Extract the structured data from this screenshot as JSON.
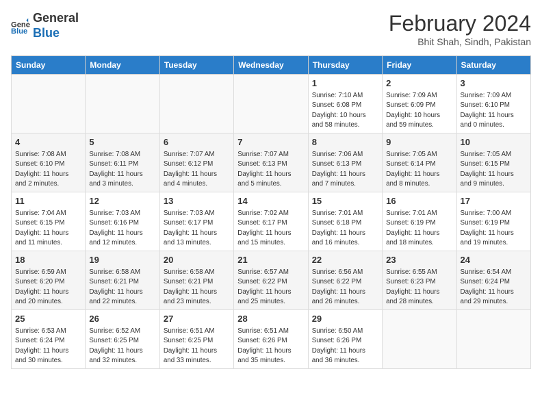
{
  "header": {
    "logo_general": "General",
    "logo_blue": "Blue",
    "month_title": "February 2024",
    "subtitle": "Bhit Shah, Sindh, Pakistan"
  },
  "days_of_week": [
    "Sunday",
    "Monday",
    "Tuesday",
    "Wednesday",
    "Thursday",
    "Friday",
    "Saturday"
  ],
  "weeks": [
    [
      {
        "day": "",
        "info": ""
      },
      {
        "day": "",
        "info": ""
      },
      {
        "day": "",
        "info": ""
      },
      {
        "day": "",
        "info": ""
      },
      {
        "day": "1",
        "info": "Sunrise: 7:10 AM\nSunset: 6:08 PM\nDaylight: 10 hours\nand 58 minutes."
      },
      {
        "day": "2",
        "info": "Sunrise: 7:09 AM\nSunset: 6:09 PM\nDaylight: 10 hours\nand 59 minutes."
      },
      {
        "day": "3",
        "info": "Sunrise: 7:09 AM\nSunset: 6:10 PM\nDaylight: 11 hours\nand 0 minutes."
      }
    ],
    [
      {
        "day": "4",
        "info": "Sunrise: 7:08 AM\nSunset: 6:10 PM\nDaylight: 11 hours\nand 2 minutes."
      },
      {
        "day": "5",
        "info": "Sunrise: 7:08 AM\nSunset: 6:11 PM\nDaylight: 11 hours\nand 3 minutes."
      },
      {
        "day": "6",
        "info": "Sunrise: 7:07 AM\nSunset: 6:12 PM\nDaylight: 11 hours\nand 4 minutes."
      },
      {
        "day": "7",
        "info": "Sunrise: 7:07 AM\nSunset: 6:13 PM\nDaylight: 11 hours\nand 5 minutes."
      },
      {
        "day": "8",
        "info": "Sunrise: 7:06 AM\nSunset: 6:13 PM\nDaylight: 11 hours\nand 7 minutes."
      },
      {
        "day": "9",
        "info": "Sunrise: 7:05 AM\nSunset: 6:14 PM\nDaylight: 11 hours\nand 8 minutes."
      },
      {
        "day": "10",
        "info": "Sunrise: 7:05 AM\nSunset: 6:15 PM\nDaylight: 11 hours\nand 9 minutes."
      }
    ],
    [
      {
        "day": "11",
        "info": "Sunrise: 7:04 AM\nSunset: 6:15 PM\nDaylight: 11 hours\nand 11 minutes."
      },
      {
        "day": "12",
        "info": "Sunrise: 7:03 AM\nSunset: 6:16 PM\nDaylight: 11 hours\nand 12 minutes."
      },
      {
        "day": "13",
        "info": "Sunrise: 7:03 AM\nSunset: 6:17 PM\nDaylight: 11 hours\nand 13 minutes."
      },
      {
        "day": "14",
        "info": "Sunrise: 7:02 AM\nSunset: 6:17 PM\nDaylight: 11 hours\nand 15 minutes."
      },
      {
        "day": "15",
        "info": "Sunrise: 7:01 AM\nSunset: 6:18 PM\nDaylight: 11 hours\nand 16 minutes."
      },
      {
        "day": "16",
        "info": "Sunrise: 7:01 AM\nSunset: 6:19 PM\nDaylight: 11 hours\nand 18 minutes."
      },
      {
        "day": "17",
        "info": "Sunrise: 7:00 AM\nSunset: 6:19 PM\nDaylight: 11 hours\nand 19 minutes."
      }
    ],
    [
      {
        "day": "18",
        "info": "Sunrise: 6:59 AM\nSunset: 6:20 PM\nDaylight: 11 hours\nand 20 minutes."
      },
      {
        "day": "19",
        "info": "Sunrise: 6:58 AM\nSunset: 6:21 PM\nDaylight: 11 hours\nand 22 minutes."
      },
      {
        "day": "20",
        "info": "Sunrise: 6:58 AM\nSunset: 6:21 PM\nDaylight: 11 hours\nand 23 minutes."
      },
      {
        "day": "21",
        "info": "Sunrise: 6:57 AM\nSunset: 6:22 PM\nDaylight: 11 hours\nand 25 minutes."
      },
      {
        "day": "22",
        "info": "Sunrise: 6:56 AM\nSunset: 6:22 PM\nDaylight: 11 hours\nand 26 minutes."
      },
      {
        "day": "23",
        "info": "Sunrise: 6:55 AM\nSunset: 6:23 PM\nDaylight: 11 hours\nand 28 minutes."
      },
      {
        "day": "24",
        "info": "Sunrise: 6:54 AM\nSunset: 6:24 PM\nDaylight: 11 hours\nand 29 minutes."
      }
    ],
    [
      {
        "day": "25",
        "info": "Sunrise: 6:53 AM\nSunset: 6:24 PM\nDaylight: 11 hours\nand 30 minutes."
      },
      {
        "day": "26",
        "info": "Sunrise: 6:52 AM\nSunset: 6:25 PM\nDaylight: 11 hours\nand 32 minutes."
      },
      {
        "day": "27",
        "info": "Sunrise: 6:51 AM\nSunset: 6:25 PM\nDaylight: 11 hours\nand 33 minutes."
      },
      {
        "day": "28",
        "info": "Sunrise: 6:51 AM\nSunset: 6:26 PM\nDaylight: 11 hours\nand 35 minutes."
      },
      {
        "day": "29",
        "info": "Sunrise: 6:50 AM\nSunset: 6:26 PM\nDaylight: 11 hours\nand 36 minutes."
      },
      {
        "day": "",
        "info": ""
      },
      {
        "day": "",
        "info": ""
      }
    ]
  ]
}
